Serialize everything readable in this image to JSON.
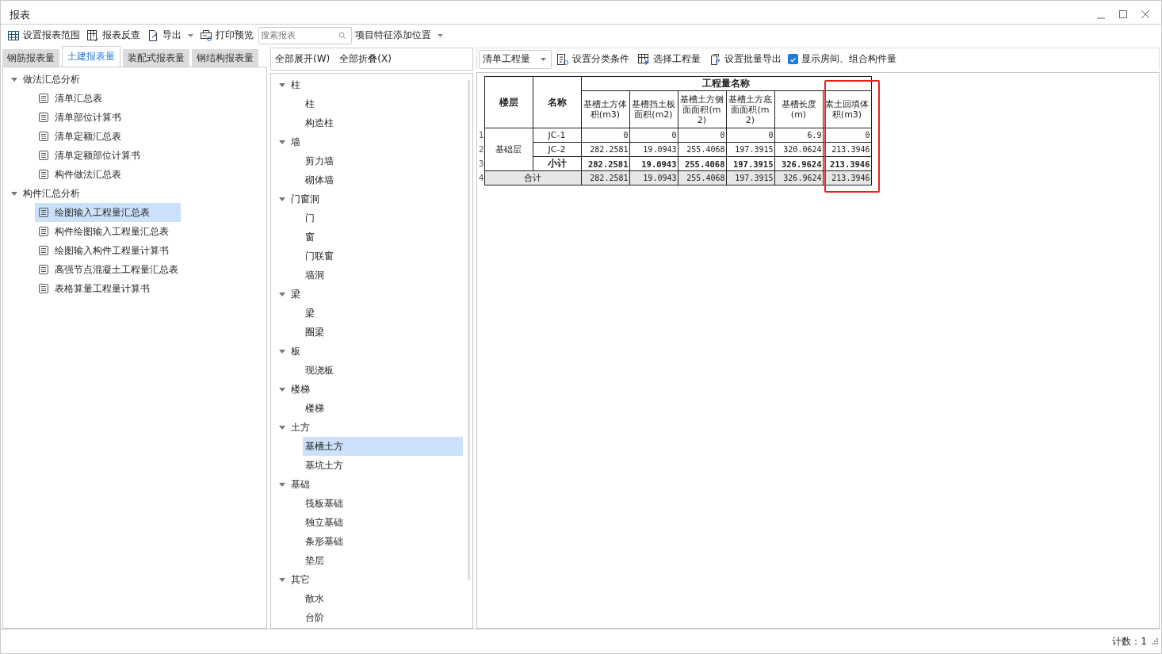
{
  "window": {
    "title": "报表"
  },
  "toolbar": {
    "buttons": [
      {
        "label": "设置报表范围",
        "dropdown": false
      },
      {
        "label": "报表反查",
        "dropdown": false
      },
      {
        "label": "导出",
        "dropdown": true
      },
      {
        "label": "打印预览",
        "dropdown": false
      }
    ],
    "search": {
      "placeholder": "搜索报表"
    },
    "position_menu": "项目特征添加位置"
  },
  "tabs": [
    {
      "label": "钢筋报表量",
      "selected": false
    },
    {
      "label": "土建报表量",
      "selected": true
    },
    {
      "label": "装配式报表量",
      "selected": false
    },
    {
      "label": "钢结构报表量",
      "selected": false
    }
  ],
  "report_tree": [
    {
      "label": "做法汇总分析",
      "expanded": true,
      "children": [
        {
          "label": "清单汇总表",
          "selected": false
        },
        {
          "label": "清单部位计算书",
          "selected": false
        },
        {
          "label": "清单定额汇总表",
          "selected": false
        },
        {
          "label": "清单定额部位计算书",
          "selected": false
        },
        {
          "label": "构件做法汇总表",
          "selected": false
        }
      ]
    },
    {
      "label": "构件汇总分析",
      "expanded": true,
      "children": [
        {
          "label": "绘图输入工程量汇总表",
          "selected": true
        },
        {
          "label": "构件绘图输入工程量汇总表",
          "selected": false
        },
        {
          "label": "绘图输入构件工程量计算书",
          "selected": false
        },
        {
          "label": "高强节点混凝土工程量汇总表",
          "selected": false
        },
        {
          "label": "表格算量工程量计算书",
          "selected": false
        }
      ]
    }
  ],
  "middle": {
    "actions": [
      "全部展开(W)",
      "全部折叠(X)"
    ],
    "tree": [
      {
        "label": "柱",
        "expanded": true,
        "children": [
          {
            "label": "柱",
            "selected": false
          },
          {
            "label": "构造柱",
            "selected": false
          }
        ]
      },
      {
        "label": "墙",
        "expanded": true,
        "children": [
          {
            "label": "剪力墙",
            "selected": false
          },
          {
            "label": "砌体墙",
            "selected": false
          }
        ]
      },
      {
        "label": "门窗洞",
        "expanded": true,
        "children": [
          {
            "label": "门",
            "selected": false
          },
          {
            "label": "窗",
            "selected": false
          },
          {
            "label": "门联窗",
            "selected": false
          },
          {
            "label": "墙洞",
            "selected": false
          }
        ]
      },
      {
        "label": "梁",
        "expanded": true,
        "children": [
          {
            "label": "梁",
            "selected": false
          },
          {
            "label": "圈梁",
            "selected": false
          }
        ]
      },
      {
        "label": "板",
        "expanded": true,
        "children": [
          {
            "label": "现浇板",
            "selected": false
          }
        ]
      },
      {
        "label": "楼梯",
        "expanded": true,
        "children": [
          {
            "label": "楼梯",
            "selected": false
          }
        ]
      },
      {
        "label": "土方",
        "expanded": true,
        "children": [
          {
            "label": "基槽土方",
            "selected": true
          },
          {
            "label": "基坑土方",
            "selected": false
          }
        ]
      },
      {
        "label": "基础",
        "expanded": true,
        "children": [
          {
            "label": "筏板基础",
            "selected": false
          },
          {
            "label": "独立基础",
            "selected": false
          },
          {
            "label": "条形基础",
            "selected": false
          },
          {
            "label": "垫层",
            "selected": false
          }
        ]
      },
      {
        "label": "其它",
        "expanded": true,
        "children": [
          {
            "label": "散水",
            "selected": false
          },
          {
            "label": "台阶",
            "selected": false
          }
        ]
      }
    ]
  },
  "right_toolbar": {
    "quantity_select": "清单工程量",
    "buttons": [
      {
        "label": "设置分类条件"
      },
      {
        "label": "选择工程量"
      },
      {
        "label": "设置批量导出"
      }
    ],
    "show_rooms": {
      "label": "显示房间、组合构件量",
      "checked": true
    }
  },
  "table": {
    "floor_header": "楼层",
    "name_header": "名称",
    "group_header": "工程量名称",
    "columns": [
      {
        "label": "基槽土方体积(m3)",
        "highlighted": false
      },
      {
        "label": "基槽挡土板面积(m2)",
        "highlighted": false
      },
      {
        "label": "基槽土方侧面面积(m2)",
        "highlighted": false
      },
      {
        "label": "基槽土方底面面积(m2)",
        "highlighted": false
      },
      {
        "label": "基槽长度(m)",
        "highlighted": false
      },
      {
        "label": "素土回填体积(m3)",
        "highlighted": true
      }
    ],
    "groups": [
      {
        "floor": "基础层",
        "rows": [
          {
            "number": "1",
            "kind": "data",
            "name": "JC-1",
            "values": [
              "0",
              "0",
              "0",
              "0",
              "6.9",
              "0"
            ]
          },
          {
            "number": "2",
            "kind": "data",
            "name": "JC-2",
            "values": [
              "282.2581",
              "19.0943",
              "255.4068",
              "197.3915",
              "320.0624",
              "213.3946"
            ]
          },
          {
            "number": "3",
            "kind": "subtotal",
            "name": "小计",
            "values": [
              "282.2581",
              "19.0943",
              "255.4068",
              "197.3915",
              "326.9624",
              "213.3946"
            ]
          }
        ]
      }
    ],
    "total": {
      "number": "4",
      "label": "合计",
      "values": [
        "282.2581",
        "19.0943",
        "255.4068",
        "197.3915",
        "326.9624",
        "213.3946"
      ]
    }
  },
  "status_bar": {
    "count": "计数：1"
  }
}
